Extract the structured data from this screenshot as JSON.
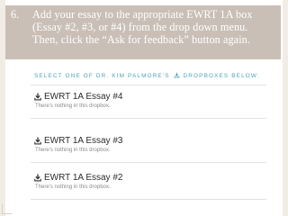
{
  "instruction": {
    "number": "6.",
    "text": "Add your essay to the appropriate EWRT 1A box (Essay #2, #3, or #4) from the drop down menu. Then, click the “Ask for feedback” button again."
  },
  "panel": {
    "title_before": "SELECT ONE OF DR. KIM PALMORE'S",
    "title_after": "DROPBOXES BELOW:",
    "dropboxes": [
      {
        "title": "EWRT 1A Essay #4",
        "status": "There's nothing in this dropbox."
      },
      {
        "title": "EWRT 1A Essay #3",
        "status": "There's nothing in this dropbox."
      },
      {
        "title": "EWRT 1A Essay #2",
        "status": "There's nothing in this dropbox."
      }
    ]
  },
  "colors": {
    "instruction_bg": "#c9bfb6",
    "title_accent": "#4fa3b8"
  },
  "icons": {
    "dropbox": "download-icon"
  }
}
